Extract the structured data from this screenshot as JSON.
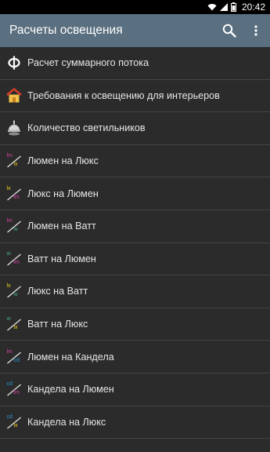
{
  "status": {
    "time": "20:42"
  },
  "header": {
    "title": "Расчеты освещения",
    "search_icon": "search-icon",
    "menu_icon": "more-vert-icon"
  },
  "colors": {
    "app_bar": "#5a6f7f",
    "background": "#2b2b2b",
    "lm": "#d0439c",
    "lx": "#f2d21c",
    "w": "#3fa98f",
    "cd": "#2c95d8"
  },
  "items": [
    {
      "label": "Расчет суммарного потока",
      "icon": "phi-icon"
    },
    {
      "label": "Требования к освещению для интерьеров",
      "icon": "house-icon"
    },
    {
      "label": "Количество светильников",
      "icon": "lamp-icon"
    },
    {
      "label": "Люмен на Люкс",
      "icon": "lm-to-lx-icon",
      "top": "lm",
      "bottom": "lx"
    },
    {
      "label": "Люкс на Люмен",
      "icon": "lx-to-lm-icon",
      "top": "lx",
      "bottom": "lm"
    },
    {
      "label": "Люмен на Ватт",
      "icon": "lm-to-w-icon",
      "top": "lm",
      "bottom": "w"
    },
    {
      "label": "Ватт на Люмен",
      "icon": "w-to-lm-icon",
      "top": "w",
      "bottom": "lm"
    },
    {
      "label": "Люкс на Ватт",
      "icon": "lx-to-w-icon",
      "top": "lx",
      "bottom": "w"
    },
    {
      "label": "Ватт на Люкс",
      "icon": "w-to-lx-icon",
      "top": "w",
      "bottom": "lx"
    },
    {
      "label": "Люмен на Кандела",
      "icon": "lm-to-cd-icon",
      "top": "lm",
      "bottom": "cd"
    },
    {
      "label": "Кандела на Люмен",
      "icon": "cd-to-lm-icon",
      "top": "cd",
      "bottom": "lm"
    },
    {
      "label": "Кандела на Люкс",
      "icon": "cd-to-lx-icon",
      "top": "cd",
      "bottom": "lx"
    }
  ]
}
